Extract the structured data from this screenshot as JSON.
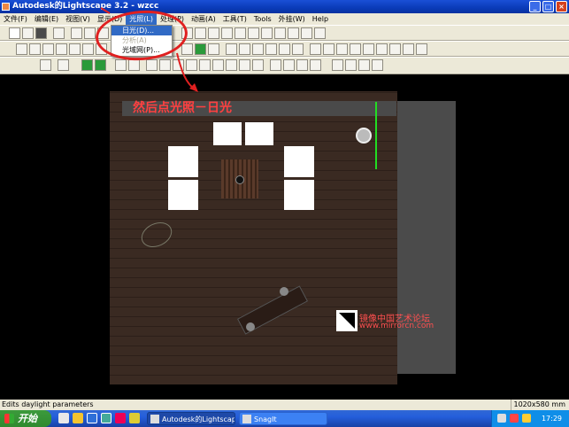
{
  "window": {
    "title": "Autodesk的Lightscape 3.2 - wzcc"
  },
  "menubar": [
    {
      "label": "文件(F)"
    },
    {
      "label": "编辑(E)"
    },
    {
      "label": "视图(V)"
    },
    {
      "label": "显示(D)"
    },
    {
      "label": "光照(L)"
    },
    {
      "label": "处理(P)"
    },
    {
      "label": "动画(A)"
    },
    {
      "label": "工具(T)"
    },
    {
      "label": "Tools"
    },
    {
      "label": "外挂(W)"
    },
    {
      "label": "Help"
    }
  ],
  "dropdown": [
    {
      "label": "日光(D)..."
    },
    {
      "label": "分析(A)"
    },
    {
      "label": "光域网(P)..."
    }
  ],
  "annotation": {
    "text": "然后点光照－日光"
  },
  "watermark": {
    "line1": "镜像中国艺术论坛",
    "line2": "www.mirrorcn.com"
  },
  "statusbar": {
    "message": "Edits daylight parameters",
    "resolution": "1020x580 mm"
  },
  "taskbar": {
    "start": "开始",
    "tasks": [
      {
        "label": "Autodesk的Lightscape..."
      },
      {
        "label": "SnagIt"
      }
    ],
    "clock": "17:29"
  },
  "colors": {
    "annotation": "#ff4040",
    "titlebar": "#0a3bb8",
    "guide_line": "#22dd22"
  }
}
